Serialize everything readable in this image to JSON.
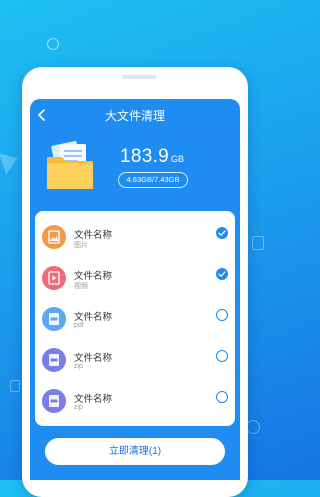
{
  "header": {
    "title": "大文件清理"
  },
  "summary": {
    "size_value": "183.9",
    "size_unit": "GB",
    "usage": "4.63GB/7.43GB"
  },
  "files": [
    {
      "name": "文件名称",
      "type": "图片",
      "icon": "image-file-icon",
      "icon_color": "#f39a4a",
      "checked": true
    },
    {
      "name": "文件名称",
      "type": "视频",
      "icon": "video-file-icon",
      "icon_color": "#ef6a7a",
      "checked": true
    },
    {
      "name": "文件名称",
      "type": "pdf",
      "icon": "pdf-file-icon",
      "icon_color": "#5aa7f2",
      "checked": false
    },
    {
      "name": "文件名称",
      "type": "zip",
      "icon": "zip-file-icon",
      "icon_color": "#7b7ee6",
      "checked": false
    },
    {
      "name": "文件名称",
      "type": "zip",
      "icon": "zip-file-icon",
      "icon_color": "#7b7ee6",
      "checked": false
    }
  ],
  "actions": {
    "clean_label": "立即清理(1)"
  },
  "colors": {
    "accent": "#1e8cf0",
    "background_top": "#1ec0f3",
    "background_bottom": "#1675e3"
  }
}
